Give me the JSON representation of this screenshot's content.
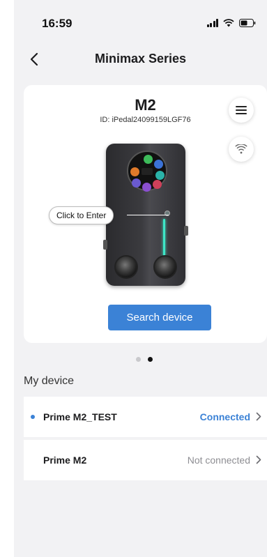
{
  "status_bar": {
    "time": "16:59"
  },
  "nav": {
    "title": "Minimax Series"
  },
  "device_card": {
    "model": "M2",
    "id_text": "ID: iPedal24099159LGF76",
    "enter_label": "Click to Enter",
    "search_button": "Search device"
  },
  "pager": {
    "pages": 2,
    "active_index": 1
  },
  "my_device": {
    "title": "My device",
    "items": [
      {
        "name": "Prime M2_TEST",
        "status": "Connected"
      },
      {
        "name": "Prime M2",
        "status": "Not connected"
      }
    ]
  },
  "colors": {
    "accent": "#3b82d6",
    "background": "#f2f2f4",
    "led": "#3ee6c6"
  },
  "icons": [
    "back-chevron-icon",
    "list-menu-icon",
    "wifi-icon",
    "chevron-right-icon"
  ]
}
